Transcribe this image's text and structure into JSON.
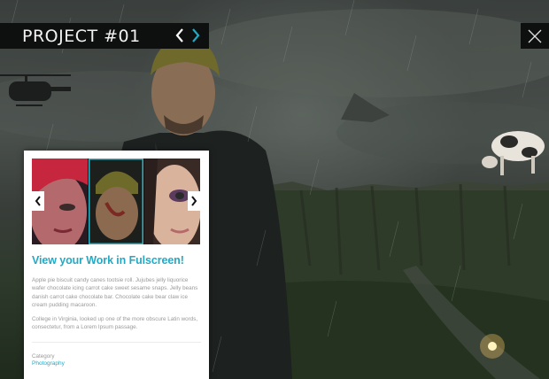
{
  "header": {
    "title": "PROJECT #01",
    "prev_icon": "chevron-left-icon",
    "next_icon": "chevron-right-icon",
    "close_icon": "close-x-icon"
  },
  "gallery": {
    "prev_icon": "chevron-left-icon",
    "next_icon": "chevron-right-icon",
    "selected_index": 1
  },
  "card": {
    "heading": "View your Work in Fulscreen!",
    "paragraph_1_lines": [
      "Apple pie biscuit candy canes tootsie roll. Jujubes jelly liquorice",
      "wafer chocolate icing carrot cake sweet sesame snaps. Jelly beans",
      "danish carrot cake chocolate bar. Chocolate cake bear claw ice",
      "cream pudding macaroon."
    ],
    "paragraph_2_lines": [
      "College in Virginia, looked up one of the more obscure Latin words,",
      "consectetur, from a Lorem Ipsum passage."
    ],
    "category_label": "Category",
    "category_value": "Photography"
  },
  "colors": {
    "accent": "#23a9c4",
    "bar_bg": "#0e0f0f"
  }
}
